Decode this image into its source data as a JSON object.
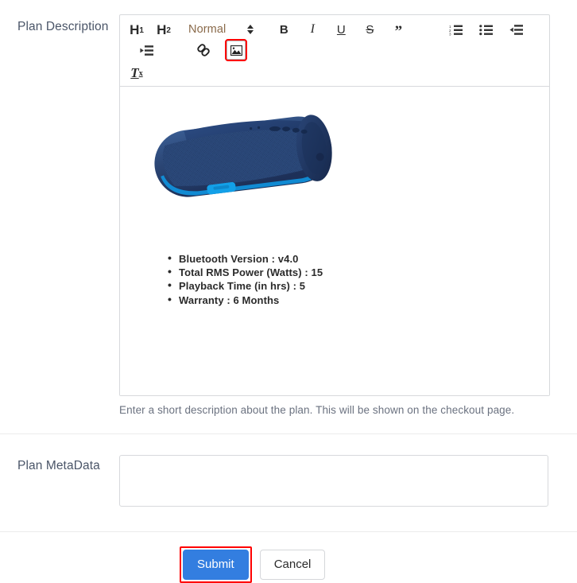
{
  "form": {
    "description": {
      "label": "Plan Description",
      "help_text": "Enter a short description about the plan. This will be shown on the checkout page."
    },
    "metadata": {
      "label": "Plan MetaData",
      "value": "",
      "placeholder": ""
    }
  },
  "editor": {
    "toolbar": {
      "h1_label": "H",
      "h1_sub": "1",
      "h2_label": "H",
      "h2_sub": "2",
      "format_select_value": "Normal",
      "bold_label": "B",
      "italic_label": "I",
      "underline_label": "U",
      "strike_label": "S",
      "blockquote_label": "”",
      "ordered_list_name": "ordered-list",
      "bullet_list_name": "bullet-list",
      "outdent_name": "outdent",
      "indent_name": "indent",
      "link_name": "link",
      "image_name": "image",
      "clear_format_label": "T",
      "clear_format_sub": "x"
    },
    "content": {
      "image_alt": "blue portable bluetooth speaker",
      "bullets": [
        "Bluetooth Version : v4.0",
        "Total RMS Power (Watts) : 15",
        "Playback Time (in hrs) : 5",
        "Warranty : 6 Months"
      ]
    }
  },
  "footer": {
    "submit_label": "Submit",
    "cancel_label": "Cancel"
  },
  "colors": {
    "primary_button": "#337ee0",
    "highlight": "#ff0000",
    "label_text": "#4a5568",
    "help_text": "#6b7280",
    "speaker_body": "#2e4a7a",
    "speaker_accent": "#0f95e0",
    "format_select_text": "#8a6a4a"
  }
}
